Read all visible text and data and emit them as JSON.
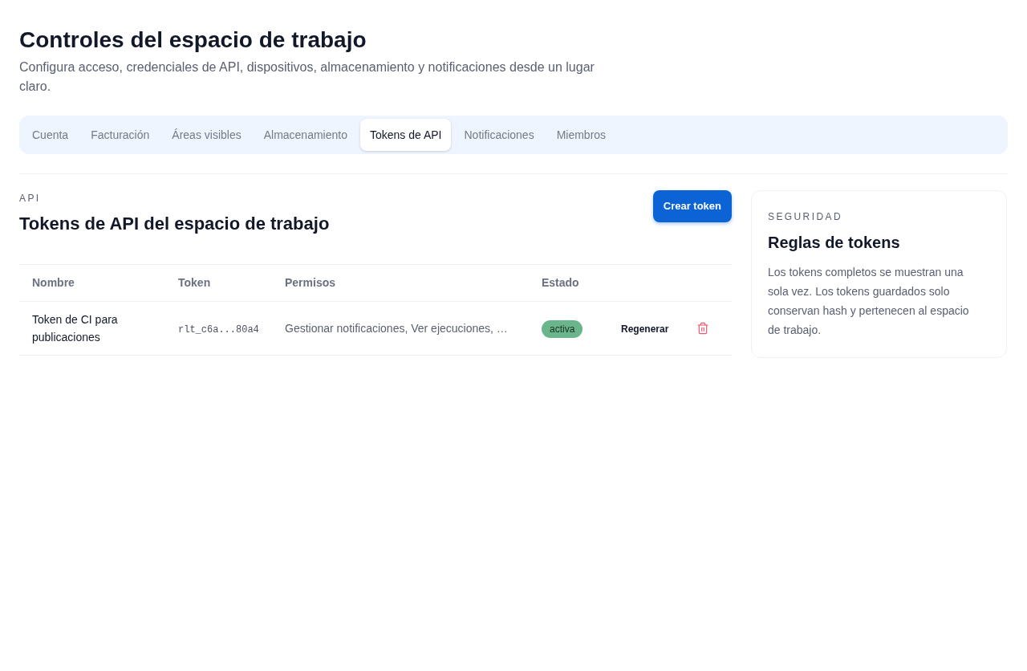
{
  "header": {
    "title": "Controles del espacio de trabajo",
    "subtitle": "Configura acceso, credenciales de API, dispositivos, almacenamiento y notificaciones desde un lugar claro."
  },
  "tabs": [
    {
      "label": "Cuenta",
      "selected": false
    },
    {
      "label": "Facturación",
      "selected": false
    },
    {
      "label": "Áreas visibles",
      "selected": false
    },
    {
      "label": "Almacenamiento",
      "selected": false
    },
    {
      "label": "Tokens de API",
      "selected": true
    },
    {
      "label": "Notificaciones",
      "selected": false
    },
    {
      "label": "Miembros",
      "selected": false
    }
  ],
  "section": {
    "eyebrow": "API",
    "title": "Tokens de API del espacio de trabajo",
    "create_button": "Crear token"
  },
  "table": {
    "columns": [
      "Nombre",
      "Token",
      "Permisos",
      "Estado"
    ],
    "rows": [
      {
        "name": "Token de CI para publicaciones",
        "token": "rlt_c6a...80a4",
        "permissions": "Gestionar notificaciones, Ver ejecuciones, …",
        "status": "activa",
        "action": "Regenerar"
      }
    ]
  },
  "sidebar_card": {
    "eyebrow": "SEGURIDAD",
    "title": "Reglas de tokens",
    "body": "Los tokens completos se muestran una sola vez. Los tokens guardados solo conservan hash y pertenecen al espacio de trabajo."
  }
}
